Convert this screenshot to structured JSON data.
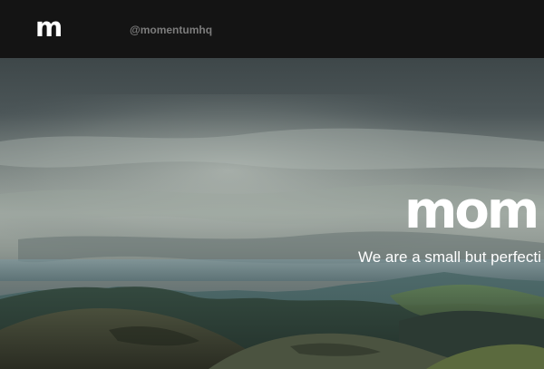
{
  "header": {
    "logo_text": "m",
    "twitter_handle": "@momentumhq"
  },
  "hero": {
    "title": "mom",
    "tagline": "We are a small but perfecti"
  },
  "colors": {
    "header_bg": "#141414",
    "handle_text": "#7c7c7c",
    "hero_text": "#ffffff"
  }
}
